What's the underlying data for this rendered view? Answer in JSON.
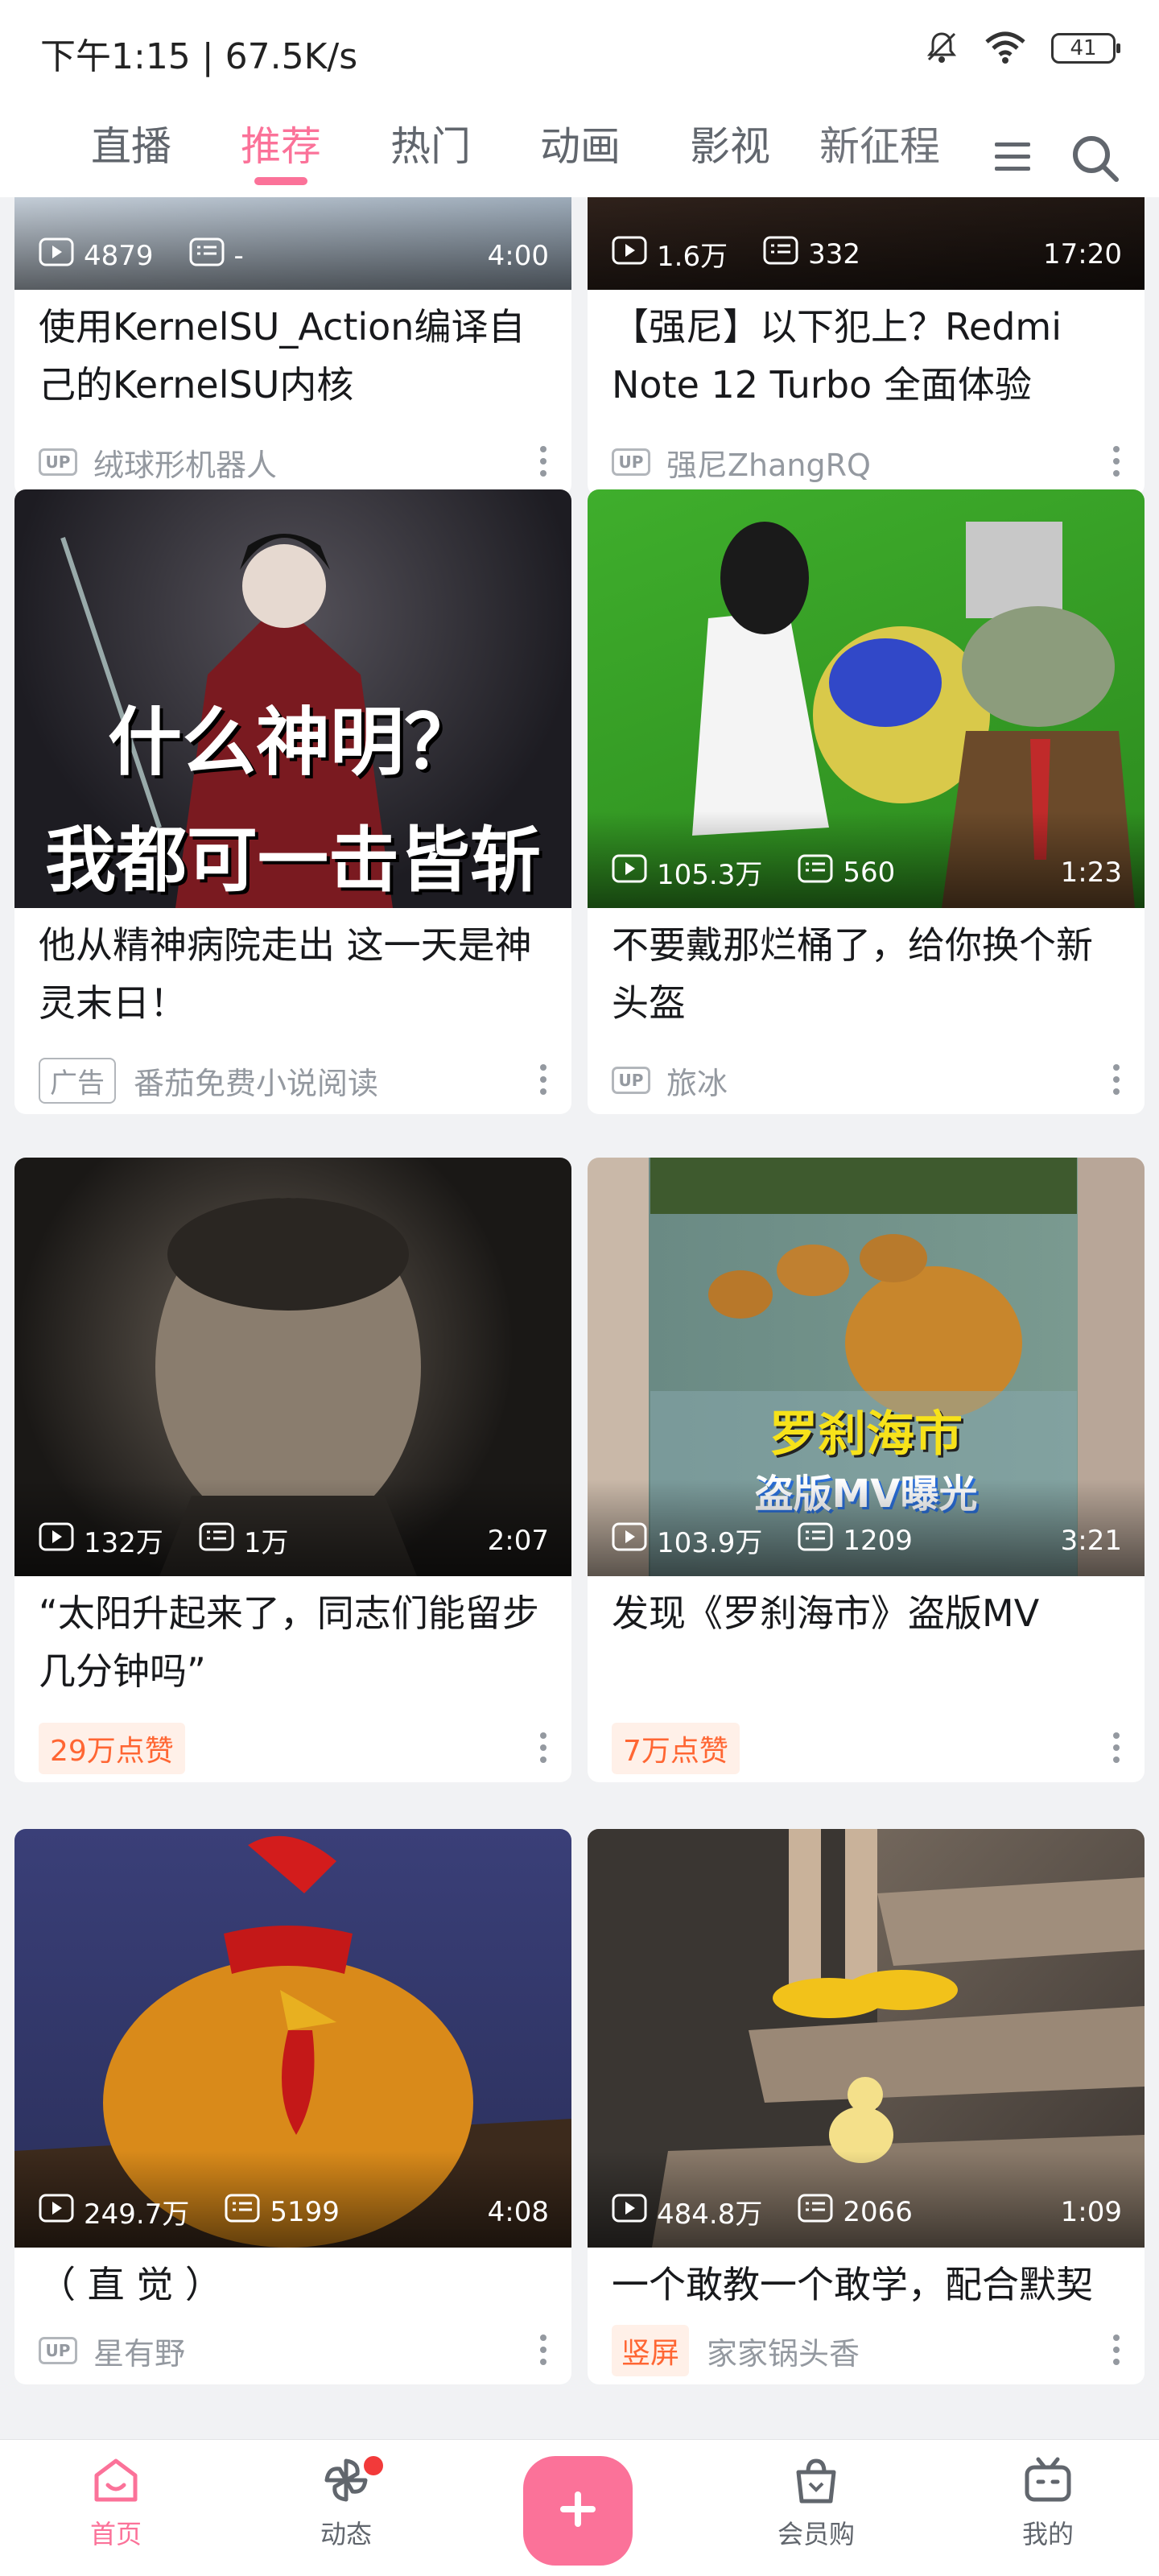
{
  "status": {
    "time_speed": "下午1:15 | 67.5K/s",
    "battery": "41"
  },
  "tabs": [
    {
      "label": "直播"
    },
    {
      "label": "推荐"
    },
    {
      "label": "热门"
    },
    {
      "label": "动画"
    },
    {
      "label": "影视"
    },
    {
      "label": "新征程"
    }
  ],
  "cards": [
    {
      "plays": "4879",
      "danmaku": "-",
      "duration": "4:00",
      "title": "使用KernelSU_Action编译自己的KernelSU内核",
      "author": "绒球形机器人",
      "badge": "UP"
    },
    {
      "plays": "1.6万",
      "danmaku": "332",
      "duration": "17:20",
      "title": "【强尼】以下犯上？Redmi Note 12 Turbo 全面体验",
      "author": "强尼ZhangRQ",
      "badge": "UP"
    },
    {
      "thumb_line1": "什么神明？",
      "thumb_line2": "我都可一击皆斩",
      "title": "他从精神病院走出 这一天是神灵末日！",
      "author": "番茄免费小说阅读",
      "badge": "广告"
    },
    {
      "plays": "105.3万",
      "danmaku": "560",
      "duration": "1:23",
      "title": "不要戴那烂桶了，给你换个新头盔",
      "author": "旅冰",
      "badge": "UP"
    },
    {
      "plays": "132万",
      "danmaku": "1万",
      "duration": "2:07",
      "title": "“太阳升起来了，同志们能留步几分钟吗”",
      "likes": "29万点赞"
    },
    {
      "plays": "103.9万",
      "danmaku": "1209",
      "duration": "3:21",
      "thumb_line1": "罗刹海市",
      "thumb_line2": "盗版MV曝光",
      "title": "发现《罗刹海市》盗版MV",
      "likes": "7万点赞"
    },
    {
      "plays": "249.7万",
      "danmaku": "5199",
      "duration": "4:08",
      "title": "（ 直 觉 ）",
      "author": "星有野",
      "badge": "UP"
    },
    {
      "plays": "484.8万",
      "danmaku": "2066",
      "duration": "1:09",
      "title": "一个敢教一个敢学，配合默契",
      "author": "家家锅头香",
      "vertical": "竖屏"
    }
  ],
  "nav": [
    {
      "label": "首页"
    },
    {
      "label": "动态"
    },
    {
      "label": "会员购"
    },
    {
      "label": "我的"
    }
  ],
  "colors": {
    "accent": "#fb7299",
    "like": "#ff6633"
  }
}
